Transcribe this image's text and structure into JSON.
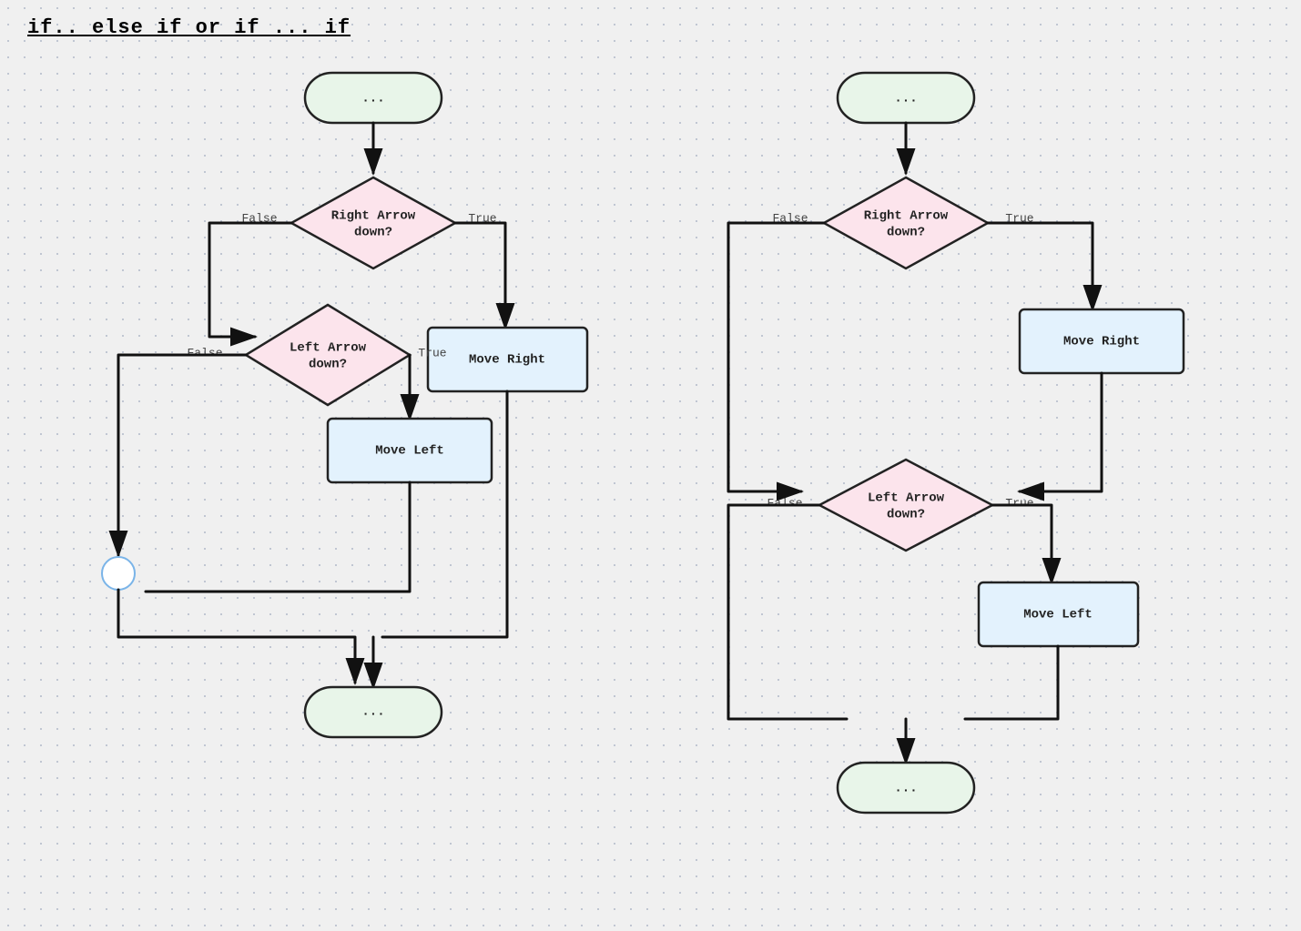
{
  "title": "if.. else if or if ... if",
  "left_diagram": {
    "start_label": "...",
    "decision1_label": "Right Arrow\ndown?",
    "decision1_true": "True",
    "decision1_false": "False",
    "process1_label": "Move Right",
    "decision2_label": "Left Arrow\ndown?",
    "decision2_true": "True",
    "decision2_false": "False",
    "process2_label": "Move Left",
    "end_label": "..."
  },
  "right_diagram": {
    "start_label": "...",
    "decision1_label": "Right Arrow\ndown?",
    "decision1_true": "True",
    "decision1_false": "False",
    "process1_label": "Move Right",
    "decision2_label": "Left Arrow\ndown?",
    "decision2_true": "True",
    "decision2_false": "False",
    "process2_label": "Move Left",
    "end_label": "..."
  }
}
